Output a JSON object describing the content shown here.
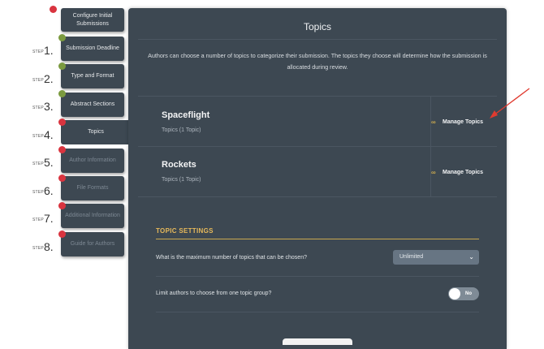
{
  "steps": [
    {
      "label": "Configure Initial Submissions",
      "word": "",
      "num": "",
      "dot": "#d9343f"
    },
    {
      "label": "Submission Deadline",
      "word": "STEP",
      "num": "1.",
      "dot": "#7b9a3f"
    },
    {
      "label": "Type and Format",
      "word": "STEP",
      "num": "2.",
      "dot": "#7b9a3f"
    },
    {
      "label": "Abstract Sections",
      "word": "STEP",
      "num": "3.",
      "dot": "#7b9a3f"
    },
    {
      "label": "Topics",
      "word": "STEP",
      "num": "4.",
      "dot": "#d9343f"
    },
    {
      "label": "Author Information",
      "word": "STEP",
      "num": "5.",
      "dot": "#d9343f"
    },
    {
      "label": "File Formats",
      "word": "STEP",
      "num": "6.",
      "dot": "#d9343f"
    },
    {
      "label": "Additional Information",
      "word": "STEP",
      "num": "7.",
      "dot": "#d9343f"
    },
    {
      "label": "Guide for Authors",
      "word": "STEP",
      "num": "8.",
      "dot": "#d9343f"
    }
  ],
  "panel": {
    "title": "Topics",
    "description": "Authors can choose a number of topics to categorize their submission. The topics they choose will determine how the submission is allocated during review."
  },
  "topics": [
    {
      "name": "Spaceflight",
      "count": "Topics (1 Topic)",
      "action": "Manage Topics"
    },
    {
      "name": "Rockets",
      "count": "Topics (1 Topic)",
      "action": "Manage Topics"
    }
  ],
  "settings": {
    "heading": "TOPIC SETTINGS",
    "max_question": "What is the maximum number of topics that can be chosen?",
    "max_value": "Unlimited",
    "limit_question": "Limit authors to choose from one topic group?",
    "limit_toggle": "No"
  },
  "colors": {
    "accent": "#c9a84f",
    "panel": "#3d4852",
    "incomplete": "#d9343f",
    "complete": "#7b9a3f",
    "annotation": "#e03a2f"
  }
}
